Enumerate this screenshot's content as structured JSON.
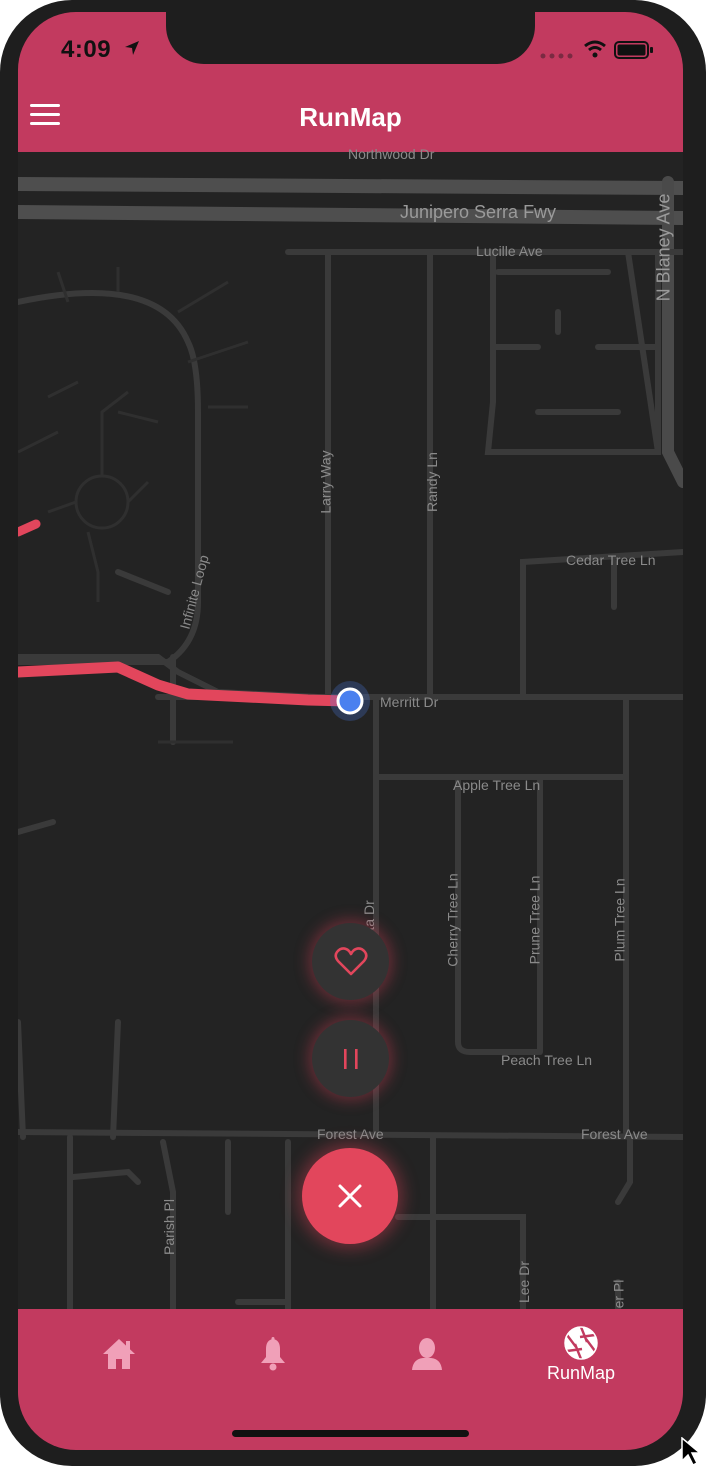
{
  "status_bar": {
    "time": "4:09"
  },
  "header": {
    "title": "RunMap"
  },
  "map": {
    "labels": {
      "northwood": "Northwood Dr",
      "junipero": "Junipero Serra Fwy",
      "lucille": "Lucille Ave",
      "blaney": "N Blaney Ave",
      "larry": "Larry Way",
      "randy": "Randy Ln",
      "infinite": "Infinite Loop",
      "cedar": "Cedar Tree Ln",
      "merritt": "Merritt Dr",
      "apple": "Apple Tree Ln",
      "vista": "Vista Dr",
      "cherry": "Cherry Tree Ln",
      "prune": "Prune Tree Ln",
      "plum": "Plum Tree Ln",
      "peach": "Peach Tree Ln",
      "forest1": "Forest Ave",
      "forest2": "Forest Ave",
      "parish": "Parish Pl",
      "lee": "Lee Dr",
      "er": "er Pl"
    },
    "route_color": "#e2465c",
    "location_color": "#4a80ef"
  },
  "actions": {
    "favorite_icon": "heart-icon",
    "pause_icon": "pause-icon",
    "stop_icon": "close-icon"
  },
  "tabbar": {
    "tabs": [
      {
        "icon": "home-icon",
        "label": ""
      },
      {
        "icon": "bell-icon",
        "label": ""
      },
      {
        "icon": "user-icon",
        "label": ""
      },
      {
        "icon": "aperture-icon",
        "label": "RunMap",
        "active": true
      }
    ]
  },
  "colors": {
    "accent": "#c23a5f",
    "map_bg": "#232323",
    "fab": "#e2465c"
  }
}
